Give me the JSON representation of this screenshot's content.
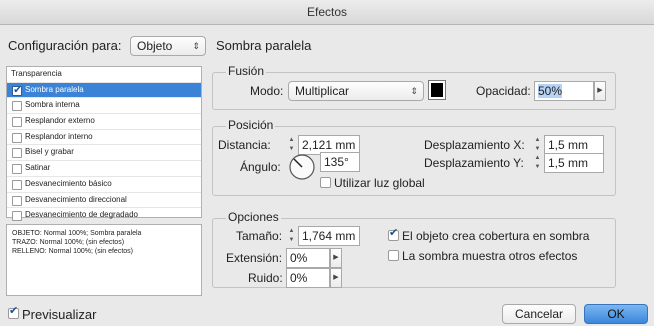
{
  "window": {
    "title": "Efectos"
  },
  "header": {
    "config_label": "Configuración para:",
    "config_value": "Objeto",
    "section_title": "Sombra paralela"
  },
  "effects_list": {
    "header": "Transparencia",
    "items": [
      {
        "label": "Sombra paralela",
        "checked": true,
        "selected": true
      },
      {
        "label": "Sombra interna",
        "checked": false
      },
      {
        "label": "Resplandor externo",
        "checked": false
      },
      {
        "label": "Resplandor interno",
        "checked": false
      },
      {
        "label": "Bisel y grabar",
        "checked": false
      },
      {
        "label": "Satinar",
        "checked": false
      },
      {
        "label": "Desvanecimiento básico",
        "checked": false
      },
      {
        "label": "Desvanecimiento direccional",
        "checked": false
      },
      {
        "label": "Desvanecimiento de degradado",
        "checked": false
      }
    ]
  },
  "summary": {
    "lines": [
      "OBJETO: Normal 100%; Sombra paralela",
      "TRAZO: Normal 100%; (sin efectos)",
      "RELLENO: Normal 100%; (sin efectos)"
    ]
  },
  "fusion": {
    "title": "Fusión",
    "mode_label": "Modo:",
    "mode_value": "Multiplicar",
    "opacity_label": "Opacidad:",
    "opacity_value": "50%",
    "swatch_color": "#000000"
  },
  "position": {
    "title": "Posición",
    "distance_label": "Distancia:",
    "distance_value": "2,121 mm",
    "angle_label": "Ángulo:",
    "angle_value": "135°",
    "global_light_label": "Utilizar luz global",
    "offset_x_label": "Desplazamiento X:",
    "offset_x_value": "1,5 mm",
    "offset_y_label": "Desplazamiento Y:",
    "offset_y_value": "1,5 mm"
  },
  "options": {
    "title": "Opciones",
    "size_label": "Tamaño:",
    "size_value": "1,764 mm",
    "extension_label": "Extensión:",
    "extension_value": "0%",
    "noise_label": "Ruido:",
    "noise_value": "0%",
    "knockout_label": "El objeto crea cobertura en sombra",
    "knockout_checked": true,
    "honor_label": "La sombra muestra otros efectos",
    "honor_checked": false
  },
  "footer": {
    "preview_label": "Previsualizar",
    "preview_checked": true,
    "cancel_label": "Cancelar",
    "ok_label": "OK"
  },
  "colors": {
    "accent": "#3b83d6"
  }
}
